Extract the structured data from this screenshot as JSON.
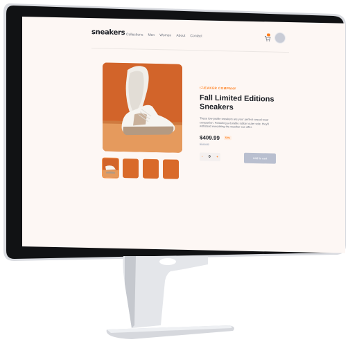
{
  "nav": {
    "logo": "sneakers",
    "links": [
      "Collections",
      "Men",
      "Women",
      "About",
      "Contact"
    ],
    "cart_icon": "cart-icon",
    "avatar": "avatar"
  },
  "product": {
    "company": "SNEAKER COMPANY",
    "title": "Fall Limited Editions Sneakers",
    "description": "These low-profile sneakers are your perfect casual wear companion. Featuring a durable rubber outer sole, they'll withstand everything the weather can offer.",
    "price": "$409.99",
    "discount": "50%",
    "old_price": "$520.00",
    "quantity": "0",
    "minus": "-",
    "plus": "+",
    "add_to_cart": "Add to cart"
  },
  "colors": {
    "accent": "#ff7d1a",
    "product_bg": "#d96a2a",
    "button": "#b9bfcf"
  }
}
